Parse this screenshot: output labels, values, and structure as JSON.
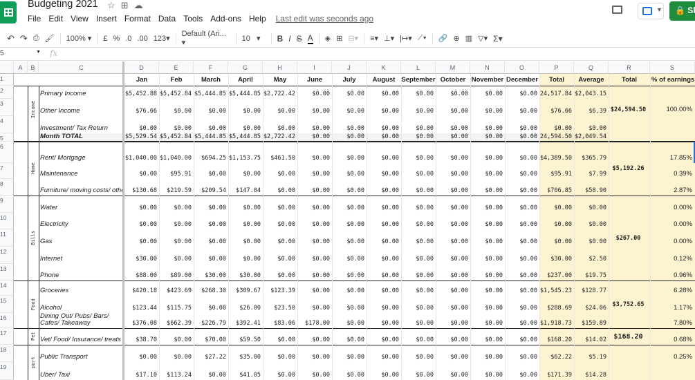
{
  "doc": {
    "title": "Budgeting 2021",
    "menus": [
      "File",
      "Edit",
      "View",
      "Insert",
      "Format",
      "Data",
      "Tools",
      "Add-ons",
      "Help"
    ],
    "last_edit": "Last edit was seconds ago",
    "share_label": "Sh"
  },
  "toolbar": {
    "zoom": "100%",
    "currency": "£",
    "percent": "%",
    "dec_less": ".0",
    "dec_more": ".00",
    "format_more": "123",
    "font": "Default (Ari...",
    "font_size": "10",
    "bold": "B",
    "italic": "I",
    "strike": "S",
    "text_color": "A",
    "sum": "Σ"
  },
  "formula": {
    "name_box": "5",
    "fx": "fx"
  },
  "columns": [
    "A",
    "B",
    "C",
    "D",
    "E",
    "F",
    "G",
    "H",
    "I",
    "J",
    "K",
    "L",
    "M",
    "N",
    "O",
    "P",
    "Q",
    "R",
    "S"
  ],
  "header_row": [
    "Jan",
    "Feb",
    "March",
    "April",
    "May",
    "June",
    "July",
    "August",
    "September",
    "October",
    "November",
    "December",
    "Total",
    "Average",
    "Total",
    "% of earnings"
  ],
  "groups": {
    "income": "Income",
    "home": "Home",
    "bills": "Bills",
    "food": "Food",
    "pet": "Pet",
    "transport": "port"
  },
  "rows": [
    {
      "num": "1",
      "label": "",
      "vals": []
    },
    {
      "num": "2",
      "label": "Primary Income",
      "vals": [
        "$5,452.88",
        "$5,452.84",
        "$5,444.85",
        "$5,444.85",
        "$2,722.42",
        "$0.00",
        "$0.00",
        "$0.00",
        "$0.00",
        "$0.00",
        "$0.00",
        "$0.00",
        "$24,517.84",
        "$2,043.15"
      ]
    },
    {
      "num": "3",
      "label": "Other Income",
      "vals": [
        "$76.66",
        "$0.00",
        "$0.00",
        "$0.00",
        "$0.00",
        "$0.00",
        "$0.00",
        "$0.00",
        "$0.00",
        "$0.00",
        "$0.00",
        "$0.00",
        "$76.66",
        "$6.39"
      ]
    },
    {
      "num": "4",
      "label": "Investment/ Tax Return",
      "vals": [
        "$0.00",
        "$0.00",
        "$0.00",
        "$0.00",
        "$0.00",
        "$0.00",
        "$0.00",
        "$0.00",
        "$0.00",
        "$0.00",
        "$0.00",
        "$0.00",
        "$0.00",
        "$0.00"
      ]
    },
    {
      "num": "5",
      "label": "Month TOTAL",
      "vals": [
        "$5,529.54",
        "$5,452.84",
        "$5,444.85",
        "$5,444.85",
        "$2,722.42",
        "$0.00",
        "$0.00",
        "$0.00",
        "$0.00",
        "$0.00",
        "$0.00",
        "$0.00",
        "$24,594.50",
        "$2,049.54"
      ]
    },
    {
      "num": "6",
      "label": "Rent/ Mortgage",
      "vals": [
        "$1,040.00",
        "$1,040.00",
        "$694.25",
        "$1,153.75",
        "$461.50",
        "$0.00",
        "$0.00",
        "$0.00",
        "$0.00",
        "$0.00",
        "$0.00",
        "$0.00",
        "$4,389.50",
        "$365.79"
      ],
      "pct": "17.85%"
    },
    {
      "num": "7",
      "label": "Maintenance",
      "vals": [
        "$0.00",
        "$95.91",
        "$0.00",
        "$0.00",
        "$0.00",
        "$0.00",
        "$0.00",
        "$0.00",
        "$0.00",
        "$0.00",
        "$0.00",
        "$0.00",
        "$95.91",
        "$7.99"
      ],
      "pct": "0.39%"
    },
    {
      "num": "8",
      "label": "Furniture/ moving costs/ other",
      "vals": [
        "$130.68",
        "$219.59",
        "$209.54",
        "$147.04",
        "$0.00",
        "$0.00",
        "$0.00",
        "$0.00",
        "$0.00",
        "$0.00",
        "$0.00",
        "$0.00",
        "$706.85",
        "$58.90"
      ],
      "pct": "2.87%"
    },
    {
      "num": "9",
      "label": "Water",
      "vals": [
        "$0.00",
        "$0.00",
        "$0.00",
        "$0.00",
        "$0.00",
        "$0.00",
        "$0.00",
        "$0.00",
        "$0.00",
        "$0.00",
        "$0.00",
        "$0.00",
        "$0.00",
        "$0.00"
      ],
      "pct": "0.00%"
    },
    {
      "num": "10",
      "label": "Electricity",
      "vals": [
        "$0.00",
        "$0.00",
        "$0.00",
        "$0.00",
        "$0.00",
        "$0.00",
        "$0.00",
        "$0.00",
        "$0.00",
        "$0.00",
        "$0.00",
        "$0.00",
        "$0.00",
        "$0.00"
      ],
      "pct": "0.00%"
    },
    {
      "num": "11",
      "label": "Gas",
      "vals": [
        "$0.00",
        "$0.00",
        "$0.00",
        "$0.00",
        "$0.00",
        "$0.00",
        "$0.00",
        "$0.00",
        "$0.00",
        "$0.00",
        "$0.00",
        "$0.00",
        "$0.00",
        "$0.00"
      ],
      "pct": "0.00%"
    },
    {
      "num": "12",
      "label": "Internet",
      "vals": [
        "$30.00",
        "$0.00",
        "$0.00",
        "$0.00",
        "$0.00",
        "$0.00",
        "$0.00",
        "$0.00",
        "$0.00",
        "$0.00",
        "$0.00",
        "$0.00",
        "$30.00",
        "$2.50"
      ],
      "pct": "0.12%"
    },
    {
      "num": "13",
      "label": "Phone",
      "vals": [
        "$88.00",
        "$89.00",
        "$30.00",
        "$30.00",
        "$0.00",
        "$0.00",
        "$0.00",
        "$0.00",
        "$0.00",
        "$0.00",
        "$0.00",
        "$0.00",
        "$237.00",
        "$19.75"
      ],
      "pct": "0.96%"
    },
    {
      "num": "14",
      "label": "Groceries",
      "vals": [
        "$420.18",
        "$423.69",
        "$268.30",
        "$309.67",
        "$123.39",
        "$0.00",
        "$0.00",
        "$0.00",
        "$0.00",
        "$0.00",
        "$0.00",
        "$0.00",
        "$1,545.23",
        "$128.77"
      ],
      "pct": "6.28%"
    },
    {
      "num": "15",
      "label": "Alcohol",
      "vals": [
        "$123.44",
        "$115.75",
        "$0.00",
        "$26.00",
        "$23.50",
        "$0.00",
        "$0.00",
        "$0.00",
        "$0.00",
        "$0.00",
        "$0.00",
        "$0.00",
        "$288.69",
        "$24.06"
      ],
      "pct": "1.17%"
    },
    {
      "num": "16",
      "label": "Dining Out/ Pubs/ Bars/ Cafes/ Takeaway",
      "vals": [
        "$376.08",
        "$662.39",
        "$226.79",
        "$392.41",
        "$83.06",
        "$178.00",
        "$0.00",
        "$0.00",
        "$0.00",
        "$0.00",
        "$0.00",
        "$0.00",
        "$1,918.73",
        "$159.89"
      ],
      "pct": "7.80%"
    },
    {
      "num": "17",
      "label": "Vet/ Food/ Insurance/ treats",
      "vals": [
        "$38.70",
        "$0.00",
        "$70.00",
        "$59.50",
        "$0.00",
        "$0.00",
        "$0.00",
        "$0.00",
        "$0.00",
        "$0.00",
        "$0.00",
        "$0.00",
        "$168.20",
        "$14.02"
      ],
      "pct": "0.68%"
    },
    {
      "num": "18",
      "label": "Public Transport",
      "vals": [
        "$0.00",
        "$0.00",
        "$27.22",
        "$35.00",
        "$0.00",
        "$0.00",
        "$0.00",
        "$0.00",
        "$0.00",
        "$0.00",
        "$0.00",
        "$0.00",
        "$62.22",
        "$5.19"
      ],
      "pct": "0.25%"
    },
    {
      "num": "19",
      "label": "Uber/ Taxi",
      "vals": [
        "$17.10",
        "$113.24",
        "$0.00",
        "$41.05",
        "$0.00",
        "$0.00",
        "$0.00",
        "$0.00",
        "$0.00",
        "$0.00",
        "$0.00",
        "$0.00",
        "$171.39",
        "$14.28"
      ],
      "pct": ""
    }
  ],
  "group_totals": {
    "income_total": "$24,594.50",
    "income_pct": "100.00%",
    "home_total": "$5,192.26",
    "bills_total": "$267.00",
    "food_total": "$3,752.65",
    "pet_total": "$168.20"
  }
}
